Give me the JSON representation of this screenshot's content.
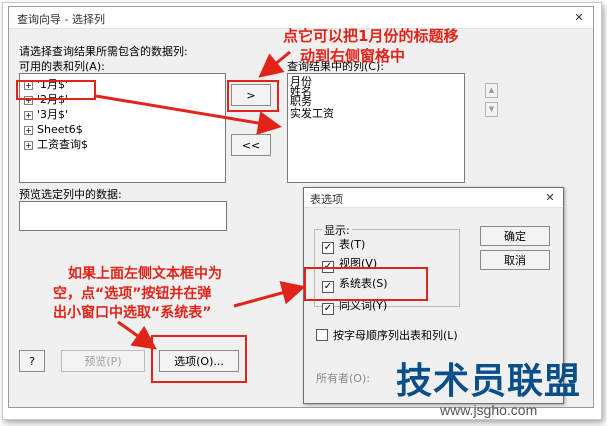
{
  "main_dialog": {
    "title": "查询向导 - 选择列",
    "close_glyph": "✕",
    "scroll_up_glyph": "▲",
    "scroll_down_glyph": "▼",
    "prompt_label": "请选择查询结果所需包含的数据列:",
    "available_label": "可用的表和列(A):",
    "tables": [
      {
        "label": "'1月$'"
      },
      {
        "label": "'2月$'"
      },
      {
        "label": "'3月$'"
      },
      {
        "label": "Sheet6$"
      },
      {
        "label": "工资查询$"
      }
    ],
    "expand_glyph": "+",
    "add_button": ">",
    "remove_all_button": "<<",
    "result_columns_label": "查询结果中的列(C):",
    "result_columns": [
      "月份",
      "姓名",
      "职务",
      "实发工资"
    ],
    "preview_label": "预览选定列中的数据:",
    "help_button": "?",
    "preview_button": "预览(P)",
    "options_button": "选项(O)...",
    "owner_label": "所有者(O):"
  },
  "options_dialog": {
    "title": "表选项",
    "close_glyph": "✕",
    "check_glyph": "✓",
    "display_group_label": "显示:",
    "options": [
      {
        "label": "表(T)",
        "checked": true
      },
      {
        "label": "视图(V)",
        "checked": true
      },
      {
        "label": "系统表(S)",
        "checked": true
      },
      {
        "label": "同义词(Y)",
        "checked": true
      }
    ],
    "sort_option": {
      "label": "按字母顺序列出表和列(L)",
      "checked": false
    },
    "ok_button": "确定",
    "cancel_button": "取消"
  },
  "annotations": {
    "top_line1": "点它可以把1月份的标题移",
    "top_line2": "动到右侧窗格中",
    "left_line1": "如果上面左侧文本框中为",
    "left_line2": "空，点“选项”按钮并在弹",
    "left_line3": "出小窗口中选取“系统表”",
    "color": "#e2231a"
  },
  "watermark": {
    "brand": "技术员联盟",
    "url": "www.jsgho.com"
  }
}
